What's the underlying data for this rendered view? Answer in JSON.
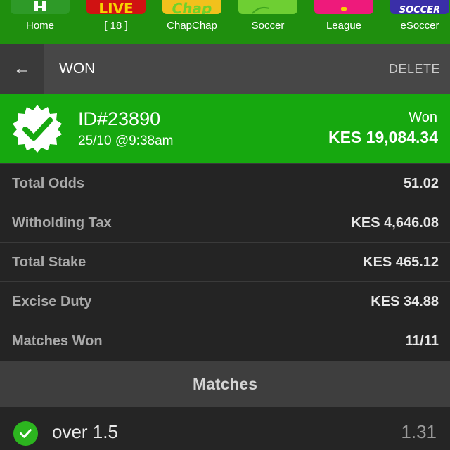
{
  "nav": {
    "items": [
      {
        "label": "Home",
        "tile_text": "",
        "tile_color": "#2e9a28",
        "text_color": "#ffffff"
      },
      {
        "label": "[ 18 ]",
        "tile_text": "LIVE",
        "tile_color": "#d01212",
        "text_color": "#f7d300"
      },
      {
        "label": "ChapChap",
        "tile_text": "Chap",
        "tile_color": "#f2c11c",
        "text_color": "#6fd22a"
      },
      {
        "label": "Soccer",
        "tile_text": "",
        "tile_color": "#6ecf33",
        "text_color": "#ffffff"
      },
      {
        "label": "League",
        "tile_text": "",
        "tile_color": "#ee1a7b",
        "text_color": "#f7d300"
      },
      {
        "label": "eSoccer",
        "tile_text": "SOCCER",
        "tile_color": "#3a2fa8",
        "text_color": "#ffffff"
      }
    ]
  },
  "header": {
    "back_icon": "←",
    "title": "WON",
    "delete_label": "DELETE"
  },
  "bet": {
    "id": "ID#23890",
    "date": "25/10 @9:38am",
    "status": "Won",
    "amount": "KES 19,084.34",
    "badge_icon": "verified-badge-icon"
  },
  "details": [
    {
      "label": "Total Odds",
      "value": "51.02"
    },
    {
      "label": "Witholding Tax",
      "value": "KES 4,646.08"
    },
    {
      "label": "Total Stake",
      "value": "KES 465.12"
    },
    {
      "label": "Excise Duty",
      "value": "KES 34.88"
    },
    {
      "label": "Matches Won",
      "value": "11/11"
    }
  ],
  "matches": {
    "title": "Matches",
    "items": [
      {
        "name": "over 1.5",
        "odds": "1.31"
      }
    ]
  },
  "colors": {
    "nav_bg": "#1f8f0e",
    "won_green": "#16a80f",
    "row_bg": "#242424"
  }
}
